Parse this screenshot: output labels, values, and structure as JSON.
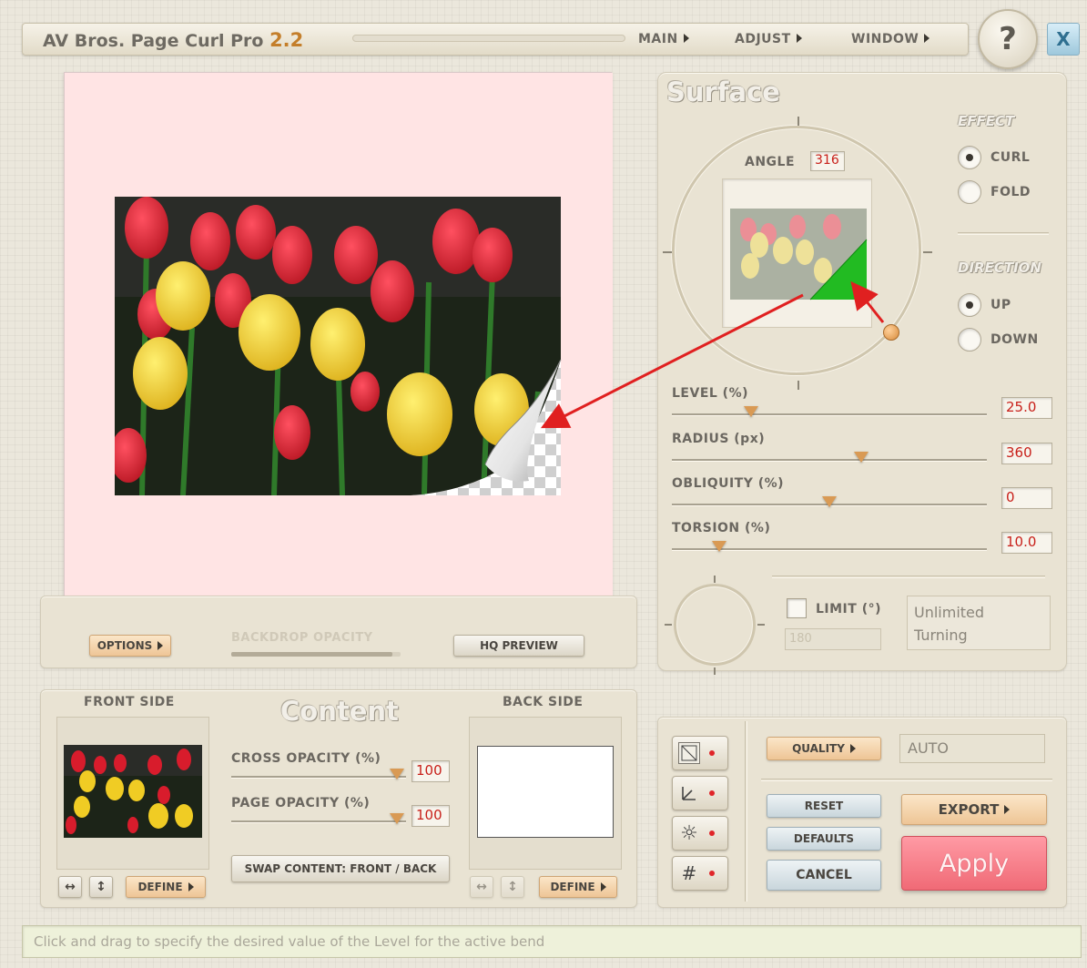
{
  "app": {
    "title_name": "AV Bros. Page Curl Pro",
    "title_version": "2.2"
  },
  "menu": {
    "items": [
      "MAIN",
      "ADJUST",
      "WINDOW"
    ],
    "help_label": "?",
    "close_label": "X"
  },
  "preview": {
    "background_color": "#ffe4e4",
    "options_label": "OPTIONS",
    "backdrop_opacity_label": "BACKDROP OPACITY",
    "backdrop_opacity_value": 0.95,
    "hq_preview_label": "HQ PREVIEW"
  },
  "surface": {
    "heading": "Surface",
    "angle_label": "ANGLE",
    "angle_value": "316",
    "effect": {
      "heading": "EFFECT",
      "options": [
        "CURL",
        "FOLD"
      ],
      "selected": "CURL"
    },
    "direction": {
      "heading": "DIRECTION",
      "options": [
        "UP",
        "DOWN"
      ],
      "selected": "UP"
    },
    "sliders": [
      {
        "label": "LEVEL (%)",
        "value": "25.0",
        "position": 0.25
      },
      {
        "label": "RADIUS (px)",
        "value": "360",
        "position": 0.6
      },
      {
        "label": "OBLIQUITY (%)",
        "value": "0",
        "position": 0.5
      },
      {
        "label": "TORSION (%)",
        "value": "10.0",
        "position": 0.15
      }
    ],
    "limit": {
      "label": "LIMIT (°)",
      "checked": false,
      "value_placeholder": "180",
      "info_line1": "Unlimited",
      "info_line2": "Turning"
    }
  },
  "content": {
    "heading": "Content",
    "front_side_label": "FRONT SIDE",
    "back_side_label": "BACK SIDE",
    "cross_opacity_label": "CROSS OPACITY (%)",
    "cross_opacity_value": "100",
    "page_opacity_label": "PAGE OPACITY (%)",
    "page_opacity_value": "100",
    "swap_label": "SWAP CONTENT: FRONT / BACK",
    "define_label": "DEFINE"
  },
  "actions": {
    "quality_label": "QUALITY",
    "quality_value": "AUTO",
    "reset_label": "RESET",
    "defaults_label": "DEFAULTS",
    "cancel_label": "CANCEL",
    "export_label": "EXPORT",
    "apply_label": "Apply"
  },
  "status_bar": {
    "text": "Click and drag to specify the desired value of the Level for the active bend"
  },
  "colors": {
    "accent_red": "#e02020",
    "curl_green": "#22bb22",
    "value_red": "#c8201a"
  }
}
